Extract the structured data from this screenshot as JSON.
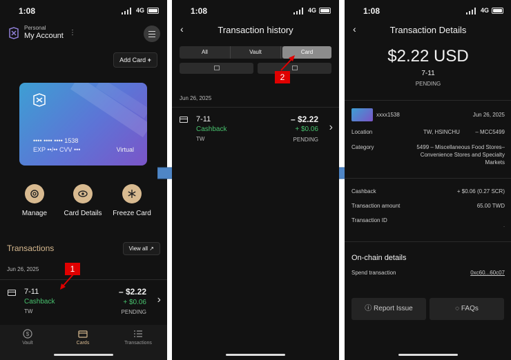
{
  "status": {
    "time": "1:08",
    "network": "4G"
  },
  "screen1": {
    "account_type": "Personal",
    "account_name": "My Account",
    "add_card_label": "Add Card",
    "card": {
      "number": "•••• •••• •••• 1538",
      "exp_cvv": "EXP ••/•• CVV •••",
      "type": "Virtual"
    },
    "actions": [
      {
        "label": "Manage",
        "icon": "gear-icon"
      },
      {
        "label": "Card Details",
        "icon": "eye-icon"
      },
      {
        "label": "Freeze Card",
        "icon": "snowflake-icon"
      }
    ],
    "transactions_title": "Transactions",
    "view_all_label": "View all ↗",
    "date": "Jun 26, 2025",
    "tx": {
      "merchant": "7-11",
      "reward": "Cashback",
      "country": "TW",
      "amount": "– $2.22",
      "cashback": "+ $0.06",
      "status": "PENDING"
    },
    "tabs": [
      {
        "label": "Vault",
        "icon": "dollar-icon"
      },
      {
        "label": "Cards",
        "icon": "card-icon"
      },
      {
        "label": "Transactions",
        "icon": "list-icon"
      }
    ],
    "callout": "1"
  },
  "screen2": {
    "title": "Transaction history",
    "segments": [
      "All",
      "Vault",
      "Card"
    ],
    "selected_segment": "Card",
    "date": "Jun 26, 2025",
    "tx": {
      "merchant": "7-11",
      "reward": "Cashback",
      "country": "TW",
      "amount": "– $2.22",
      "cashback": "+ $0.06",
      "status": "PENDING"
    },
    "callout": "2"
  },
  "screen3": {
    "title": "Transaction Details",
    "amount": "$2.22 USD",
    "merchant": "7-11",
    "status": "PENDING",
    "card_masked": "xxxx1538",
    "date": "Jun 26, 2025",
    "location_label": "Location",
    "location_value": "TW, HSINCHU",
    "mcc": "– MCC5499",
    "category_label": "Category",
    "category_value_1": "5499 – Miscellaneous Food Stores–",
    "category_value_2": "Convenience Stores and Specialty",
    "category_value_3": "Markets",
    "cashback_label": "Cashback",
    "cashback_value": "+ $0.06 (0.27 SCR)",
    "tx_amount_label": "Transaction amount",
    "tx_amount_value": "65.00 TWD",
    "tx_id_label": "Transaction ID",
    "tx_id_value": "-",
    "onchain_title": "On-chain details",
    "spend_label": "Spend transaction",
    "spend_value": "0xc60...60c07",
    "report_label": "Report Issue",
    "faqs_label": "FAQs"
  },
  "colors": {
    "accent": "#d8ba90",
    "positive": "#48c26e",
    "background": "#121212",
    "callout": "#e00000",
    "flow_arrow": "#4f86c6"
  }
}
